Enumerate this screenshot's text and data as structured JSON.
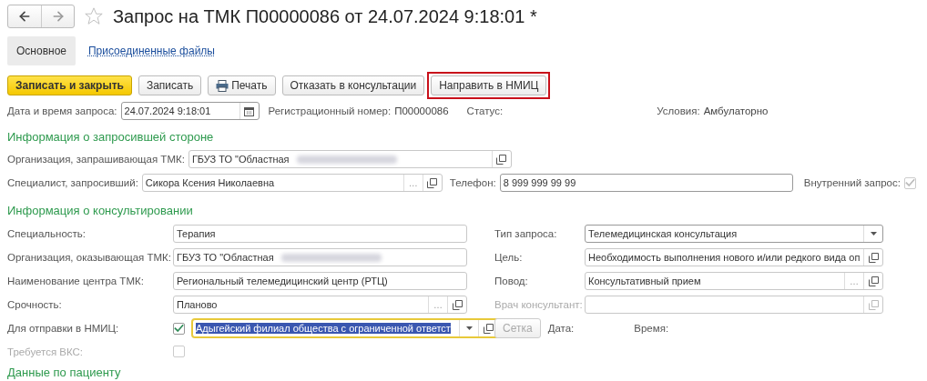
{
  "window": {
    "title": "Запрос на ТМК П00000086 от 24.07.2024 9:18:01 *",
    "favorite": false
  },
  "tabs": [
    {
      "label": "Основное",
      "selected": true
    },
    {
      "label": "Присоединенные файлы",
      "selected": false
    }
  ],
  "toolbar": [
    {
      "label": "Записать и закрыть",
      "kind": "primary",
      "highlighted": false
    },
    {
      "label": "Записать",
      "kind": "normal",
      "highlighted": false
    },
    {
      "label": "Печать",
      "kind": "print",
      "highlighted": false
    },
    {
      "label": "Отказать в консультации",
      "kind": "normal",
      "highlighted": false
    },
    {
      "label": "Направить в НМИЦ",
      "kind": "normal",
      "highlighted": true
    }
  ],
  "header": {
    "date": {
      "label": "Дата и время запроса:",
      "value": "24.07.2024  9:18:01"
    },
    "reg_number": {
      "label": "Регистрационный номер:",
      "value": "П00000086"
    },
    "status": {
      "label": "Статус:"
    },
    "conditions": {
      "label": "Условия:",
      "value": "Амбулаторно"
    }
  },
  "requester": {
    "heading": "Информация о запросившей стороне",
    "organization": {
      "label": "Организация, запрашивающая ТМК:",
      "value": "ГБУЗ ТО \"Областная",
      "redacted": true,
      "open": true
    },
    "specialist": {
      "label": "Специалист, запросивший:",
      "value": "Сикора Ксения Николаевна",
      "choose": "…",
      "open": true
    },
    "phone": {
      "label": "Телефон:",
      "value": "8 999 999 99 99"
    },
    "internal": {
      "label": "Внутренний запрос:",
      "checked": true,
      "disabled": true
    }
  },
  "consulting": {
    "heading": "Информация о консультировании",
    "left": [
      {
        "kind": "field",
        "label": "Специальность:",
        "value": "Терапия"
      },
      {
        "kind": "field",
        "label": "Организация, оказывающая ТМК:",
        "value": "ГБУЗ ТО \"Областная",
        "redacted": true
      },
      {
        "kind": "field",
        "label": "Наименование центра ТМК:",
        "value": "Региональный телемедицинский центр (РТЦ)"
      },
      {
        "kind": "field",
        "label": "Срочность:",
        "value": "Планово",
        "choose": "…",
        "open": true
      },
      {
        "kind": "check-combo",
        "label": "Для отправки в НМИЦ:",
        "checked": true,
        "value": "Адыгейский филиал общества с ограниченной ответст",
        "focused": true,
        "dropdown": true,
        "open": true
      },
      {
        "kind": "checkbox",
        "label": "Требуется ВКС:",
        "checked": false,
        "disabled": true
      }
    ],
    "right": [
      {
        "kind": "field",
        "label": "Тип запроса:",
        "value": "Телемедицинская консультация",
        "dropdown": true
      },
      {
        "kind": "field",
        "label": "Цель:",
        "value": "Необходимость выполнения нового и/или редкого вида оп",
        "open": true
      },
      {
        "kind": "field",
        "label": "Повод:",
        "value": "Консультативный прием",
        "choose": "…",
        "open": true
      },
      {
        "kind": "field",
        "label": "Врач консультант:",
        "disabled": true,
        "open": true
      },
      {
        "kind": "actions",
        "button": {
          "label": "Сетка",
          "disabled": true
        },
        "date_label": "Дата:",
        "time_label": "Время:"
      }
    ]
  },
  "patient": {
    "heading": "Данные по пациенту"
  }
}
